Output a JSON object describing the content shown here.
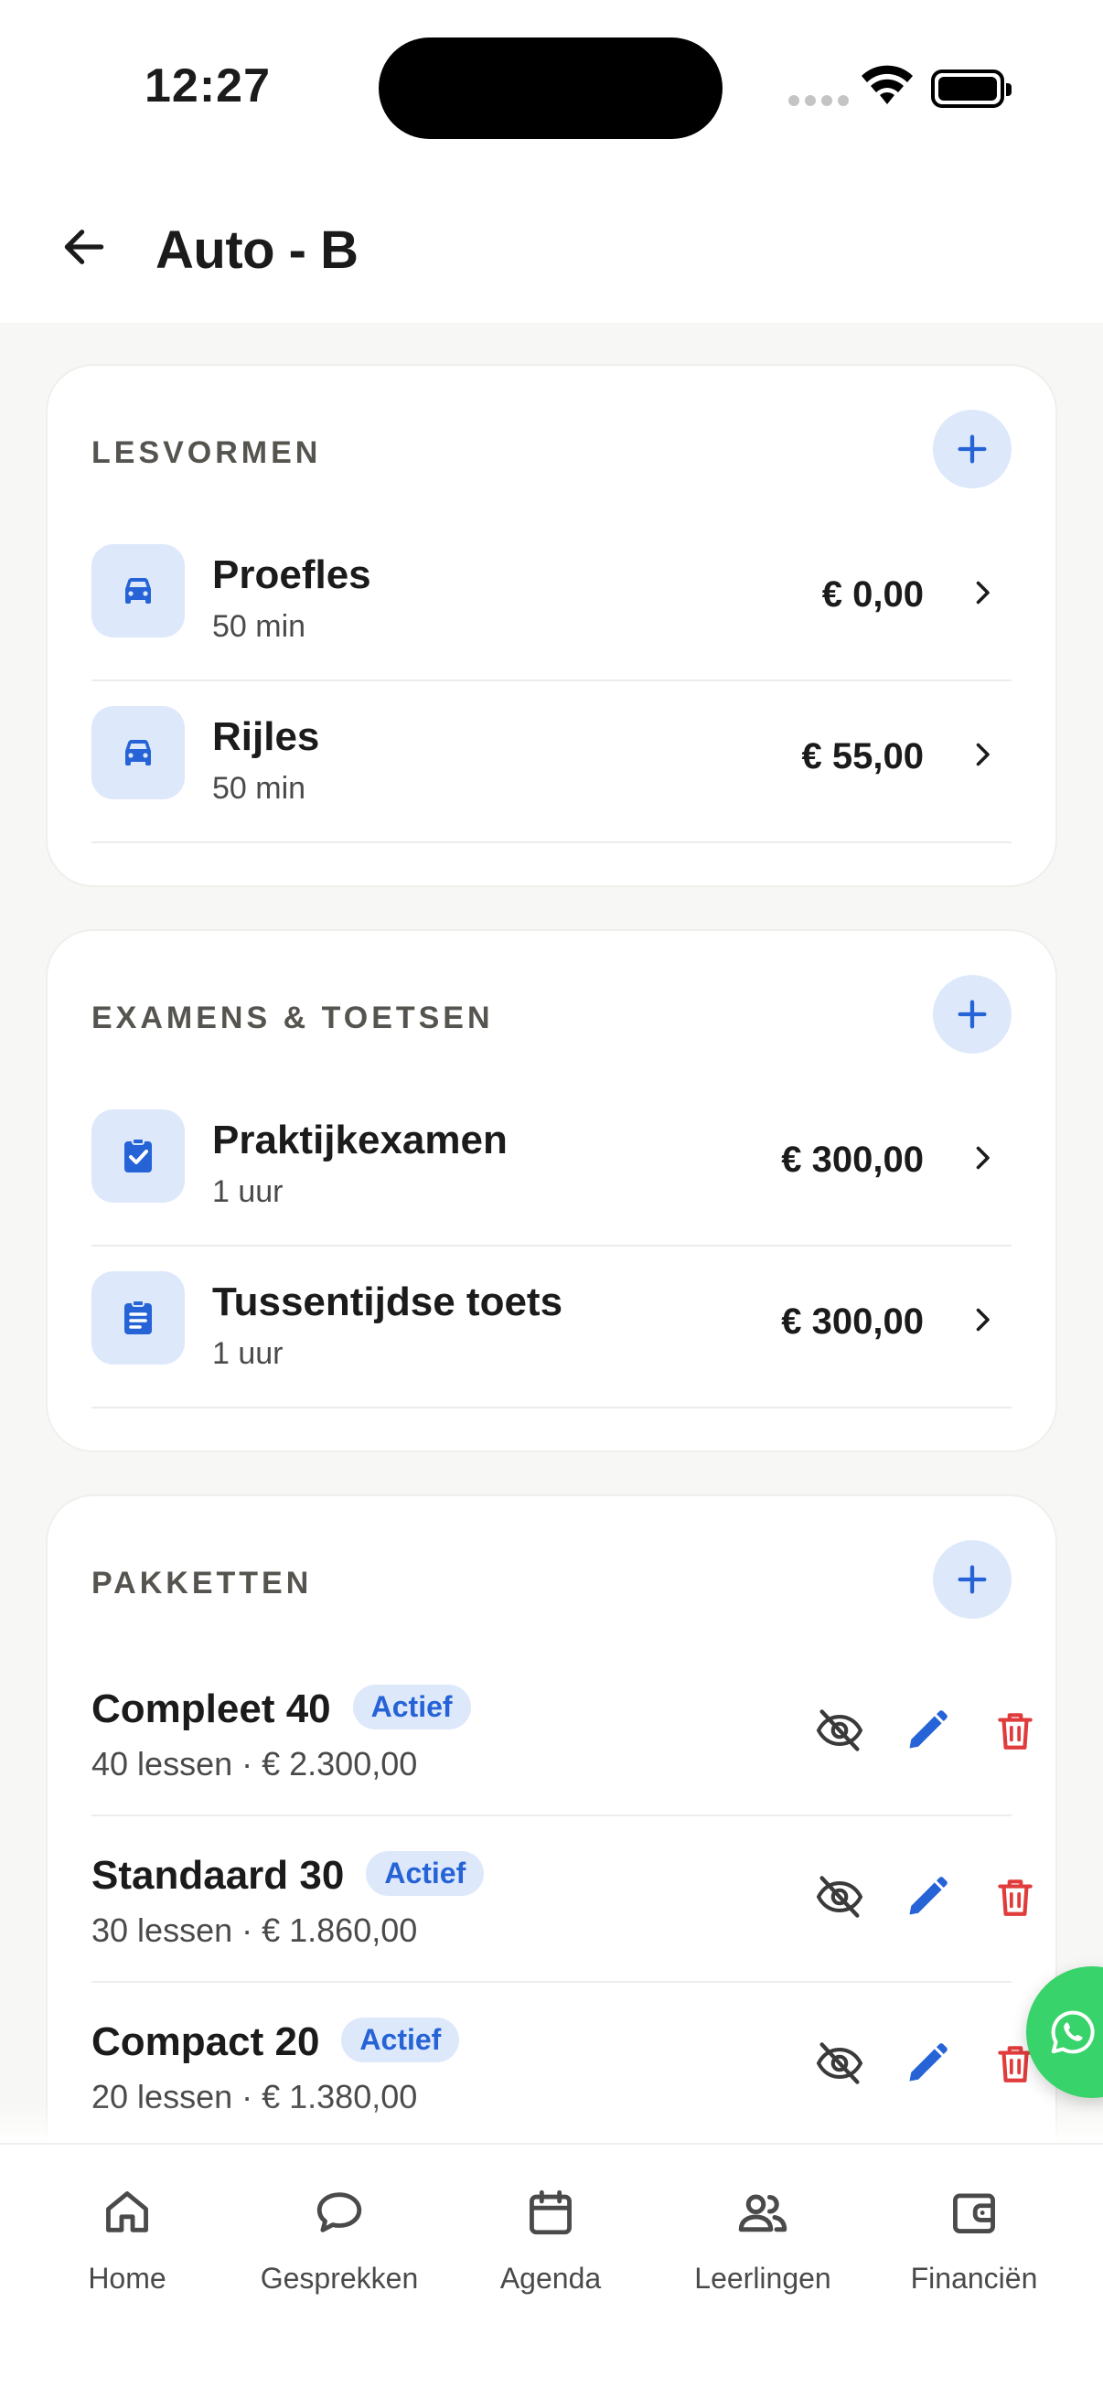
{
  "status_bar": {
    "time": "12:27"
  },
  "header": {
    "title": "Auto - B"
  },
  "lesvormen": {
    "title": "LESVORMEN",
    "items": [
      {
        "name": "Proefles",
        "duration": "50 min",
        "price": "€ 0,00",
        "icon": "car-icon"
      },
      {
        "name": "Rijles",
        "duration": "50 min",
        "price": "€ 55,00",
        "icon": "car-icon"
      }
    ]
  },
  "examens": {
    "title": "EXAMENS & TOETSEN",
    "items": [
      {
        "name": "Praktijkexamen",
        "duration": "1 uur",
        "price": "€ 300,00",
        "icon": "clipboard-check-icon"
      },
      {
        "name": "Tussentijdse toets",
        "duration": "1 uur",
        "price": "€ 300,00",
        "icon": "clipboard-list-icon"
      }
    ]
  },
  "pakketten": {
    "title": "PAKKETTEN",
    "items": [
      {
        "name": "Compleet 40",
        "badge": "Actief",
        "details": "40 lessen · € 2.300,00"
      },
      {
        "name": "Standaard 30",
        "badge": "Actief",
        "details": "30 lessen · € 1.860,00"
      },
      {
        "name": "Compact 20",
        "badge": "Actief",
        "details": "20 lessen · € 1.380,00"
      }
    ]
  },
  "tabbar": {
    "items": [
      {
        "label": "Home",
        "icon": "home-icon"
      },
      {
        "label": "Gesprekken",
        "icon": "chat-bubble-icon"
      },
      {
        "label": "Agenda",
        "icon": "calendar-icon"
      },
      {
        "label": "Leerlingen",
        "icon": "people-icon"
      },
      {
        "label": "Financiën",
        "icon": "wallet-icon"
      }
    ]
  },
  "colors": {
    "accent": "#2563d6",
    "accent_soft": "#dde8fb",
    "danger": "#e03c3c",
    "whatsapp": "#39d36b"
  }
}
